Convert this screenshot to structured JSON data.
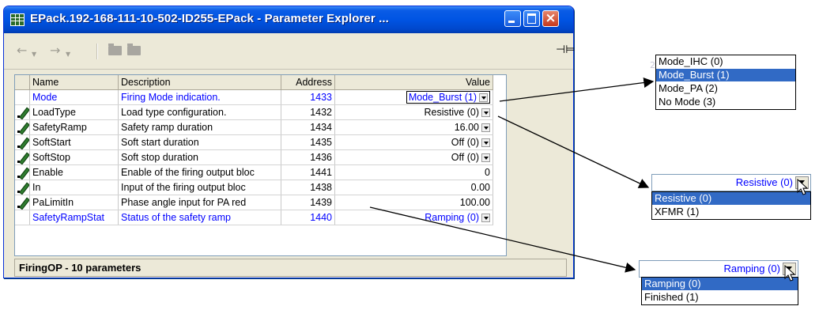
{
  "window": {
    "title": "EPack.192-168-111-10-502-ID255-EPack - Parameter Explorer ...",
    "buttons": {
      "minimize": "minimize",
      "maximize": "maximize",
      "close": "×"
    }
  },
  "toolbar": {
    "back": "←",
    "forward": "→",
    "pin": "⊣⊨"
  },
  "grid": {
    "columns": [
      "Name",
      "Description",
      "Address",
      "Value"
    ],
    "rows": [
      {
        "name": "Mode",
        "description": "Firing Mode indication.",
        "address": "1433",
        "value": "Mode_Burst (1)",
        "editable": false,
        "blue": true,
        "dropdown": true,
        "boxed": true
      },
      {
        "name": "LoadType",
        "description": "Load type configuration.",
        "address": "1432",
        "value": "Resistive (0)",
        "editable": true,
        "blue": false,
        "dropdown": true,
        "boxed": false
      },
      {
        "name": "SafetyRamp",
        "description": "Safety ramp duration",
        "address": "1434",
        "value": "16.00",
        "editable": true,
        "blue": false,
        "dropdown": true,
        "boxed": false
      },
      {
        "name": "SoftStart",
        "description": "Soft start duration",
        "address": "1435",
        "value": "Off (0)",
        "editable": true,
        "blue": false,
        "dropdown": true,
        "boxed": false
      },
      {
        "name": "SoftStop",
        "description": "Soft stop duration",
        "address": "1436",
        "value": "Off (0)",
        "editable": true,
        "blue": false,
        "dropdown": true,
        "boxed": false
      },
      {
        "name": "Enable",
        "description": "Enable of the firing output bloc",
        "address": "1441",
        "value": "0",
        "editable": true,
        "blue": false,
        "dropdown": false,
        "boxed": false
      },
      {
        "name": "In",
        "description": "Input of the firing output bloc",
        "address": "1438",
        "value": "0.00",
        "editable": true,
        "blue": false,
        "dropdown": false,
        "boxed": false
      },
      {
        "name": "PaLimitIn",
        "description": "Phase angle input for PA red",
        "address": "1439",
        "value": "100.00",
        "editable": true,
        "blue": false,
        "dropdown": false,
        "boxed": false
      },
      {
        "name": "SafetyRampStat",
        "description": "Status of the safety ramp",
        "address": "1440",
        "value": "Ramping (0)",
        "editable": false,
        "blue": true,
        "dropdown": true,
        "boxed": false
      }
    ]
  },
  "status": {
    "text": "FiringOP  -  10 parameters"
  },
  "popups": {
    "mode": {
      "items": [
        "Mode_IHC (0)",
        "Mode_Burst (1)",
        "Mode_PA (2)",
        "No Mode (3)"
      ],
      "selected": 1
    },
    "loadtype": {
      "combo_value": "Resistive (0)",
      "items": [
        "Resistive (0)",
        "XFMR (1)"
      ],
      "selected": 0
    },
    "ramp": {
      "combo_value": "Ramping (0)",
      "items": [
        "Ramping (0)",
        "Finished (1)"
      ],
      "selected": 0
    }
  },
  "colors": {
    "title_blue": "#0054e3",
    "selection": "#316ac5",
    "link_blue": "#0000ff",
    "window_bg": "#ece9d8"
  }
}
